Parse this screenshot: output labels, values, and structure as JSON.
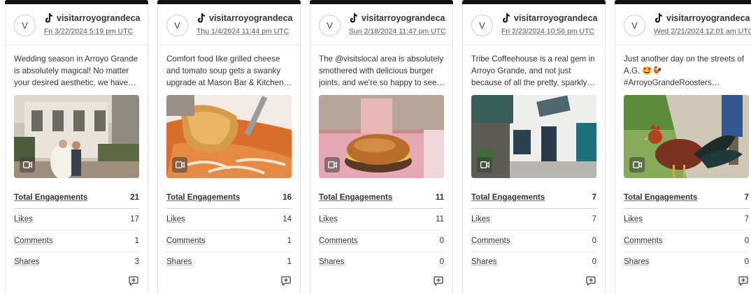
{
  "cards": [
    {
      "avatar_letter": "V",
      "handle": "visitarroyograndeca",
      "date": "Fri 3/22/2024 5:19 pm UTC",
      "caption": "Wedding season in Arroyo Grande is absolutely magical! No matter your desired aesthetic, we have the…",
      "stats": [
        {
          "label": "Total Engagements",
          "value": "21"
        },
        {
          "label": "Likes",
          "value": "17"
        },
        {
          "label": "Comments",
          "value": "1"
        },
        {
          "label": "Shares",
          "value": "3"
        }
      ],
      "thumb_icon": "video-icon"
    },
    {
      "avatar_letter": "V",
      "handle": "visitarroyograndeca",
      "date": "Thu 1/4/2024 11:44 pm UTC",
      "caption": "Comfort food like grilled cheese and tomato soup gets a swanky upgrade at Mason Bar & Kitchen in the hear…",
      "stats": [
        {
          "label": "Total Engagements",
          "value": "16"
        },
        {
          "label": "Likes",
          "value": "14"
        },
        {
          "label": "Comments",
          "value": "1"
        },
        {
          "label": "Shares",
          "value": "1"
        }
      ],
      "thumb_icon": "video-icon"
    },
    {
      "avatar_letter": "V",
      "handle": "visitarroyograndeca",
      "date": "Sun 2/18/2024 11:47 pm UTC",
      "caption": "The @visitslocal area is absolutely smothered with delicious burger joints, and we're so happy to see…",
      "stats": [
        {
          "label": "Total Engagements",
          "value": "11"
        },
        {
          "label": "Likes",
          "value": "11"
        },
        {
          "label": "Comments",
          "value": "0"
        },
        {
          "label": "Shares",
          "value": "0"
        }
      ],
      "thumb_icon": "video-icon"
    },
    {
      "avatar_letter": "V",
      "handle": "visitarroyograndeca",
      "date": "Fri 2/23/2024 10:56 pm UTC",
      "caption": "Tribe Coffeehouse is a real gem in Arroyo Grande, and not just because of all the pretty, sparkly goods the…",
      "stats": [
        {
          "label": "Total Engagements",
          "value": "7"
        },
        {
          "label": "Likes",
          "value": "7"
        },
        {
          "label": "Comments",
          "value": "0"
        },
        {
          "label": "Shares",
          "value": "0"
        }
      ],
      "thumb_icon": "video-icon"
    },
    {
      "avatar_letter": "V",
      "handle": "visitarroyograndeca",
      "date": "Wed 2/21/2024 12:01 am UTC",
      "caption": "Just another day on the streets of A.G. 🤩🐓 #ArroyoGrandeRoosters #LocalIcons #VisitArroyoGrande…",
      "stats": [
        {
          "label": "Total Engagements",
          "value": "7"
        },
        {
          "label": "Likes",
          "value": "7"
        },
        {
          "label": "Comments",
          "value": "0"
        },
        {
          "label": "Shares",
          "value": "0"
        }
      ],
      "thumb_icon": "video-icon"
    }
  ],
  "colors": {
    "top_bar": "#111111",
    "divider": "#e8e8e8",
    "text": "#333333"
  }
}
